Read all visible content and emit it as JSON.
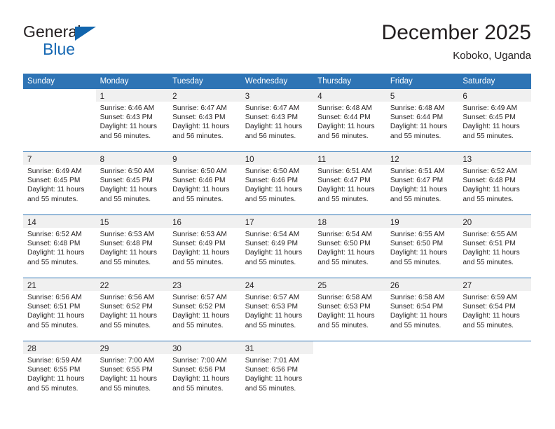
{
  "brand": {
    "name_part1": "General",
    "name_part2": "Blue",
    "triangle_color": "#1165ad",
    "blue_color": "#1668b3"
  },
  "header": {
    "title": "December 2025",
    "subtitle": "Koboko, Uganda"
  },
  "theme": {
    "header_row_bg": "#2e74b5",
    "daynum_band_bg": "#f0f0f0",
    "row_separator": "#2e74b5",
    "text": "#231f20"
  },
  "weekday_headers": [
    "Sunday",
    "Monday",
    "Tuesday",
    "Wednesday",
    "Thursday",
    "Friday",
    "Saturday"
  ],
  "weeks": [
    [
      {
        "day": "",
        "lines": []
      },
      {
        "day": "1",
        "lines": [
          "Sunrise: 6:46 AM",
          "Sunset: 6:43 PM",
          "Daylight: 11 hours",
          "and 56 minutes."
        ]
      },
      {
        "day": "2",
        "lines": [
          "Sunrise: 6:47 AM",
          "Sunset: 6:43 PM",
          "Daylight: 11 hours",
          "and 56 minutes."
        ]
      },
      {
        "day": "3",
        "lines": [
          "Sunrise: 6:47 AM",
          "Sunset: 6:43 PM",
          "Daylight: 11 hours",
          "and 56 minutes."
        ]
      },
      {
        "day": "4",
        "lines": [
          "Sunrise: 6:48 AM",
          "Sunset: 6:44 PM",
          "Daylight: 11 hours",
          "and 56 minutes."
        ]
      },
      {
        "day": "5",
        "lines": [
          "Sunrise: 6:48 AM",
          "Sunset: 6:44 PM",
          "Daylight: 11 hours",
          "and 55 minutes."
        ]
      },
      {
        "day": "6",
        "lines": [
          "Sunrise: 6:49 AM",
          "Sunset: 6:45 PM",
          "Daylight: 11 hours",
          "and 55 minutes."
        ]
      }
    ],
    [
      {
        "day": "7",
        "lines": [
          "Sunrise: 6:49 AM",
          "Sunset: 6:45 PM",
          "Daylight: 11 hours",
          "and 55 minutes."
        ]
      },
      {
        "day": "8",
        "lines": [
          "Sunrise: 6:50 AM",
          "Sunset: 6:45 PM",
          "Daylight: 11 hours",
          "and 55 minutes."
        ]
      },
      {
        "day": "9",
        "lines": [
          "Sunrise: 6:50 AM",
          "Sunset: 6:46 PM",
          "Daylight: 11 hours",
          "and 55 minutes."
        ]
      },
      {
        "day": "10",
        "lines": [
          "Sunrise: 6:50 AM",
          "Sunset: 6:46 PM",
          "Daylight: 11 hours",
          "and 55 minutes."
        ]
      },
      {
        "day": "11",
        "lines": [
          "Sunrise: 6:51 AM",
          "Sunset: 6:47 PM",
          "Daylight: 11 hours",
          "and 55 minutes."
        ]
      },
      {
        "day": "12",
        "lines": [
          "Sunrise: 6:51 AM",
          "Sunset: 6:47 PM",
          "Daylight: 11 hours",
          "and 55 minutes."
        ]
      },
      {
        "day": "13",
        "lines": [
          "Sunrise: 6:52 AM",
          "Sunset: 6:48 PM",
          "Daylight: 11 hours",
          "and 55 minutes."
        ]
      }
    ],
    [
      {
        "day": "14",
        "lines": [
          "Sunrise: 6:52 AM",
          "Sunset: 6:48 PM",
          "Daylight: 11 hours",
          "and 55 minutes."
        ]
      },
      {
        "day": "15",
        "lines": [
          "Sunrise: 6:53 AM",
          "Sunset: 6:48 PM",
          "Daylight: 11 hours",
          "and 55 minutes."
        ]
      },
      {
        "day": "16",
        "lines": [
          "Sunrise: 6:53 AM",
          "Sunset: 6:49 PM",
          "Daylight: 11 hours",
          "and 55 minutes."
        ]
      },
      {
        "day": "17",
        "lines": [
          "Sunrise: 6:54 AM",
          "Sunset: 6:49 PM",
          "Daylight: 11 hours",
          "and 55 minutes."
        ]
      },
      {
        "day": "18",
        "lines": [
          "Sunrise: 6:54 AM",
          "Sunset: 6:50 PM",
          "Daylight: 11 hours",
          "and 55 minutes."
        ]
      },
      {
        "day": "19",
        "lines": [
          "Sunrise: 6:55 AM",
          "Sunset: 6:50 PM",
          "Daylight: 11 hours",
          "and 55 minutes."
        ]
      },
      {
        "day": "20",
        "lines": [
          "Sunrise: 6:55 AM",
          "Sunset: 6:51 PM",
          "Daylight: 11 hours",
          "and 55 minutes."
        ]
      }
    ],
    [
      {
        "day": "21",
        "lines": [
          "Sunrise: 6:56 AM",
          "Sunset: 6:51 PM",
          "Daylight: 11 hours",
          "and 55 minutes."
        ]
      },
      {
        "day": "22",
        "lines": [
          "Sunrise: 6:56 AM",
          "Sunset: 6:52 PM",
          "Daylight: 11 hours",
          "and 55 minutes."
        ]
      },
      {
        "day": "23",
        "lines": [
          "Sunrise: 6:57 AM",
          "Sunset: 6:52 PM",
          "Daylight: 11 hours",
          "and 55 minutes."
        ]
      },
      {
        "day": "24",
        "lines": [
          "Sunrise: 6:57 AM",
          "Sunset: 6:53 PM",
          "Daylight: 11 hours",
          "and 55 minutes."
        ]
      },
      {
        "day": "25",
        "lines": [
          "Sunrise: 6:58 AM",
          "Sunset: 6:53 PM",
          "Daylight: 11 hours",
          "and 55 minutes."
        ]
      },
      {
        "day": "26",
        "lines": [
          "Sunrise: 6:58 AM",
          "Sunset: 6:54 PM",
          "Daylight: 11 hours",
          "and 55 minutes."
        ]
      },
      {
        "day": "27",
        "lines": [
          "Sunrise: 6:59 AM",
          "Sunset: 6:54 PM",
          "Daylight: 11 hours",
          "and 55 minutes."
        ]
      }
    ],
    [
      {
        "day": "28",
        "lines": [
          "Sunrise: 6:59 AM",
          "Sunset: 6:55 PM",
          "Daylight: 11 hours",
          "and 55 minutes."
        ]
      },
      {
        "day": "29",
        "lines": [
          "Sunrise: 7:00 AM",
          "Sunset: 6:55 PM",
          "Daylight: 11 hours",
          "and 55 minutes."
        ]
      },
      {
        "day": "30",
        "lines": [
          "Sunrise: 7:00 AM",
          "Sunset: 6:56 PM",
          "Daylight: 11 hours",
          "and 55 minutes."
        ]
      },
      {
        "day": "31",
        "lines": [
          "Sunrise: 7:01 AM",
          "Sunset: 6:56 PM",
          "Daylight: 11 hours",
          "and 55 minutes."
        ]
      },
      {
        "day": "",
        "lines": []
      },
      {
        "day": "",
        "lines": []
      },
      {
        "day": "",
        "lines": []
      }
    ]
  ]
}
